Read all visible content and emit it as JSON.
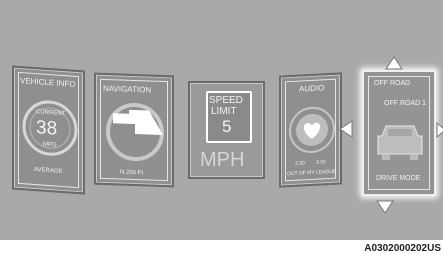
{
  "cards": {
    "vehicle_info": {
      "title": "VEHICLE INFO",
      "label_top": "CURRENT",
      "value": "38",
      "unit": "MPG",
      "footer": "AVERAGE"
    },
    "navigation": {
      "title": "NAVIGATION",
      "footer": "N 200 Ft."
    },
    "speed_limit": {
      "line1": "SPEED",
      "line2": "LIMIT",
      "value": "5",
      "unit": "MPH"
    },
    "audio": {
      "title": "AUDIO",
      "time_elapsed": "3.30",
      "time_total": "3.30",
      "song": "OUT OF MY LEAGUE"
    },
    "off_road": {
      "title": "OFF ROAD",
      "subtitle": "OFF ROAD 1",
      "footer": "DRIVE MODE"
    }
  },
  "icons": {
    "nav_arrow": "turn-arrow-icon",
    "heart": "heart-icon",
    "vehicle": "vehicle-front-icon",
    "arrows": [
      "left-arrow-icon",
      "up-arrow-icon",
      "down-arrow-icon",
      "right-arrow-icon"
    ]
  },
  "caption": "A0302000202US"
}
